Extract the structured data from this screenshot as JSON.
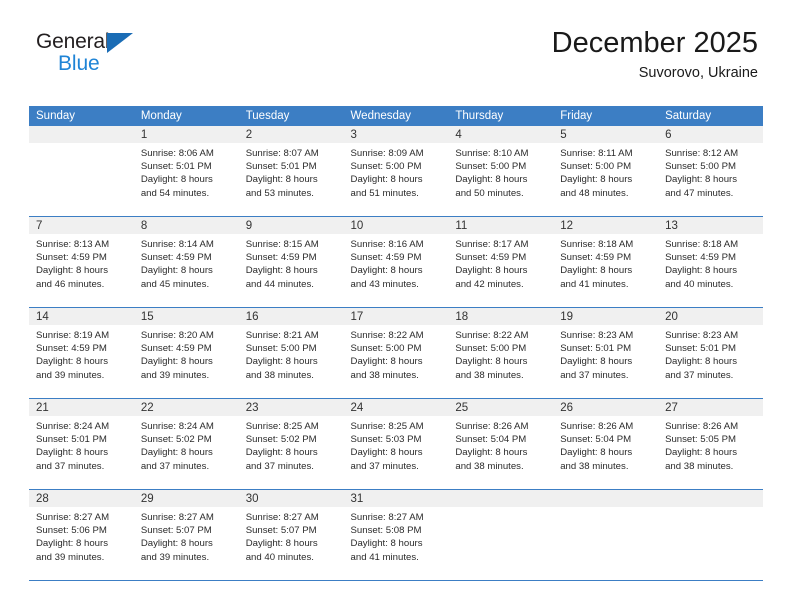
{
  "brand": {
    "name_part1": "General",
    "name_part2": "Blue",
    "accent_color": "#1f84d6",
    "triangle_color": "#1a6cb5"
  },
  "header": {
    "title": "December 2025",
    "subtitle": "Suvorovo, Ukraine"
  },
  "theme": {
    "header_bg": "#3C7EC4",
    "daynum_bg": "#F0F0F0",
    "grid_line": "#3C7EC4"
  },
  "weekday_headers": [
    "Sunday",
    "Monday",
    "Tuesday",
    "Wednesday",
    "Thursday",
    "Friday",
    "Saturday"
  ],
  "weeks": [
    [
      {
        "day": "",
        "sunrise": "",
        "sunset": "",
        "daylight1": "",
        "daylight2": ""
      },
      {
        "day": "1",
        "sunrise": "Sunrise: 8:06 AM",
        "sunset": "Sunset: 5:01 PM",
        "daylight1": "Daylight: 8 hours",
        "daylight2": "and 54 minutes."
      },
      {
        "day": "2",
        "sunrise": "Sunrise: 8:07 AM",
        "sunset": "Sunset: 5:01 PM",
        "daylight1": "Daylight: 8 hours",
        "daylight2": "and 53 minutes."
      },
      {
        "day": "3",
        "sunrise": "Sunrise: 8:09 AM",
        "sunset": "Sunset: 5:00 PM",
        "daylight1": "Daylight: 8 hours",
        "daylight2": "and 51 minutes."
      },
      {
        "day": "4",
        "sunrise": "Sunrise: 8:10 AM",
        "sunset": "Sunset: 5:00 PM",
        "daylight1": "Daylight: 8 hours",
        "daylight2": "and 50 minutes."
      },
      {
        "day": "5",
        "sunrise": "Sunrise: 8:11 AM",
        "sunset": "Sunset: 5:00 PM",
        "daylight1": "Daylight: 8 hours",
        "daylight2": "and 48 minutes."
      },
      {
        "day": "6",
        "sunrise": "Sunrise: 8:12 AM",
        "sunset": "Sunset: 5:00 PM",
        "daylight1": "Daylight: 8 hours",
        "daylight2": "and 47 minutes."
      }
    ],
    [
      {
        "day": "7",
        "sunrise": "Sunrise: 8:13 AM",
        "sunset": "Sunset: 4:59 PM",
        "daylight1": "Daylight: 8 hours",
        "daylight2": "and 46 minutes."
      },
      {
        "day": "8",
        "sunrise": "Sunrise: 8:14 AM",
        "sunset": "Sunset: 4:59 PM",
        "daylight1": "Daylight: 8 hours",
        "daylight2": "and 45 minutes."
      },
      {
        "day": "9",
        "sunrise": "Sunrise: 8:15 AM",
        "sunset": "Sunset: 4:59 PM",
        "daylight1": "Daylight: 8 hours",
        "daylight2": "and 44 minutes."
      },
      {
        "day": "10",
        "sunrise": "Sunrise: 8:16 AM",
        "sunset": "Sunset: 4:59 PM",
        "daylight1": "Daylight: 8 hours",
        "daylight2": "and 43 minutes."
      },
      {
        "day": "11",
        "sunrise": "Sunrise: 8:17 AM",
        "sunset": "Sunset: 4:59 PM",
        "daylight1": "Daylight: 8 hours",
        "daylight2": "and 42 minutes."
      },
      {
        "day": "12",
        "sunrise": "Sunrise: 8:18 AM",
        "sunset": "Sunset: 4:59 PM",
        "daylight1": "Daylight: 8 hours",
        "daylight2": "and 41 minutes."
      },
      {
        "day": "13",
        "sunrise": "Sunrise: 8:18 AM",
        "sunset": "Sunset: 4:59 PM",
        "daylight1": "Daylight: 8 hours",
        "daylight2": "and 40 minutes."
      }
    ],
    [
      {
        "day": "14",
        "sunrise": "Sunrise: 8:19 AM",
        "sunset": "Sunset: 4:59 PM",
        "daylight1": "Daylight: 8 hours",
        "daylight2": "and 39 minutes."
      },
      {
        "day": "15",
        "sunrise": "Sunrise: 8:20 AM",
        "sunset": "Sunset: 4:59 PM",
        "daylight1": "Daylight: 8 hours",
        "daylight2": "and 39 minutes."
      },
      {
        "day": "16",
        "sunrise": "Sunrise: 8:21 AM",
        "sunset": "Sunset: 5:00 PM",
        "daylight1": "Daylight: 8 hours",
        "daylight2": "and 38 minutes."
      },
      {
        "day": "17",
        "sunrise": "Sunrise: 8:22 AM",
        "sunset": "Sunset: 5:00 PM",
        "daylight1": "Daylight: 8 hours",
        "daylight2": "and 38 minutes."
      },
      {
        "day": "18",
        "sunrise": "Sunrise: 8:22 AM",
        "sunset": "Sunset: 5:00 PM",
        "daylight1": "Daylight: 8 hours",
        "daylight2": "and 38 minutes."
      },
      {
        "day": "19",
        "sunrise": "Sunrise: 8:23 AM",
        "sunset": "Sunset: 5:01 PM",
        "daylight1": "Daylight: 8 hours",
        "daylight2": "and 37 minutes."
      },
      {
        "day": "20",
        "sunrise": "Sunrise: 8:23 AM",
        "sunset": "Sunset: 5:01 PM",
        "daylight1": "Daylight: 8 hours",
        "daylight2": "and 37 minutes."
      }
    ],
    [
      {
        "day": "21",
        "sunrise": "Sunrise: 8:24 AM",
        "sunset": "Sunset: 5:01 PM",
        "daylight1": "Daylight: 8 hours",
        "daylight2": "and 37 minutes."
      },
      {
        "day": "22",
        "sunrise": "Sunrise: 8:24 AM",
        "sunset": "Sunset: 5:02 PM",
        "daylight1": "Daylight: 8 hours",
        "daylight2": "and 37 minutes."
      },
      {
        "day": "23",
        "sunrise": "Sunrise: 8:25 AM",
        "sunset": "Sunset: 5:02 PM",
        "daylight1": "Daylight: 8 hours",
        "daylight2": "and 37 minutes."
      },
      {
        "day": "24",
        "sunrise": "Sunrise: 8:25 AM",
        "sunset": "Sunset: 5:03 PM",
        "daylight1": "Daylight: 8 hours",
        "daylight2": "and 37 minutes."
      },
      {
        "day": "25",
        "sunrise": "Sunrise: 8:26 AM",
        "sunset": "Sunset: 5:04 PM",
        "daylight1": "Daylight: 8 hours",
        "daylight2": "and 38 minutes."
      },
      {
        "day": "26",
        "sunrise": "Sunrise: 8:26 AM",
        "sunset": "Sunset: 5:04 PM",
        "daylight1": "Daylight: 8 hours",
        "daylight2": "and 38 minutes."
      },
      {
        "day": "27",
        "sunrise": "Sunrise: 8:26 AM",
        "sunset": "Sunset: 5:05 PM",
        "daylight1": "Daylight: 8 hours",
        "daylight2": "and 38 minutes."
      }
    ],
    [
      {
        "day": "28",
        "sunrise": "Sunrise: 8:27 AM",
        "sunset": "Sunset: 5:06 PM",
        "daylight1": "Daylight: 8 hours",
        "daylight2": "and 39 minutes."
      },
      {
        "day": "29",
        "sunrise": "Sunrise: 8:27 AM",
        "sunset": "Sunset: 5:07 PM",
        "daylight1": "Daylight: 8 hours",
        "daylight2": "and 39 minutes."
      },
      {
        "day": "30",
        "sunrise": "Sunrise: 8:27 AM",
        "sunset": "Sunset: 5:07 PM",
        "daylight1": "Daylight: 8 hours",
        "daylight2": "and 40 minutes."
      },
      {
        "day": "31",
        "sunrise": "Sunrise: 8:27 AM",
        "sunset": "Sunset: 5:08 PM",
        "daylight1": "Daylight: 8 hours",
        "daylight2": "and 41 minutes."
      },
      {
        "day": "",
        "sunrise": "",
        "sunset": "",
        "daylight1": "",
        "daylight2": ""
      },
      {
        "day": "",
        "sunrise": "",
        "sunset": "",
        "daylight1": "",
        "daylight2": ""
      },
      {
        "day": "",
        "sunrise": "",
        "sunset": "",
        "daylight1": "",
        "daylight2": ""
      }
    ]
  ]
}
